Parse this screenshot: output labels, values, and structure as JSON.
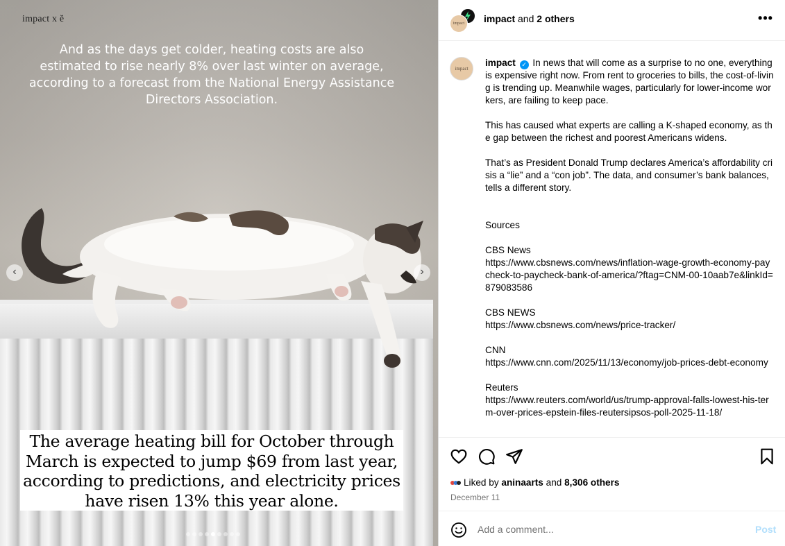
{
  "media": {
    "brand": "impact x ĕ",
    "top_caption": "And as the days get colder, heating costs are also estimated to rise nearly 8% over last winter on average, according to a forecast from the National Energy Assistance Directors Association.",
    "bottom_caption": "The average heating bill for October through March is expected to jump $69 from last year, according to predictions, and electricity prices have risen 13% this year alone.",
    "prev_icon": "chevron-left-icon",
    "next_icon": "chevron-right-icon",
    "slide_count": 9,
    "active_slide": 5
  },
  "header": {
    "username": "impact",
    "and_text": "and",
    "others": "2 others",
    "avatar_text": "impact",
    "more_icon": "more-horizontal-icon"
  },
  "caption": {
    "username": "impact",
    "avatar_text": "impact",
    "verified_icon": "verified-badge-icon",
    "first_paragraph": "In news that will come as a surprise to no one, everything is expensive right now. From rent to groceries to bills, the cost-of-living is trending up. Meanwhile wages, particularly for lower-income workers, are failing to keep pace.",
    "paragraphs": [
      "This has caused what experts are calling a K-shaped economy, as the gap between the richest and poorest Americans widens.",
      "That’s as President Donald Trump declares America’s affordability crisis a “lie” and a “con job”. The data, and consumer’s bank balances, tells a different story."
    ],
    "sources_heading": "Sources",
    "sources": [
      {
        "name": "CBS News",
        "url": "https://www.cbsnews.com/news/inflation-wage-growth-economy-paycheck-to-paycheck-bank-of-america/?ftag=CNM-00-10aab7e&linkId=879083586"
      },
      {
        "name": "CBS NEWS",
        "url": "https://www.cbsnews.com/news/price-tracker/"
      },
      {
        "name": "CNN",
        "url": "https://www.cnn.com/2025/11/13/economy/job-prices-debt-economy"
      },
      {
        "name": "Reuters",
        "url": "https://www.reuters.com/world/us/trump-approval-falls-lowest-his-term-over-prices-epstein-files-reutersipsos-poll-2025-11-18/"
      }
    ]
  },
  "actions": {
    "like_icon": "heart-icon",
    "comment_icon": "comment-icon",
    "share_icon": "send-icon",
    "save_icon": "bookmark-icon",
    "liked_by_prefix": "Liked by",
    "liked_by_user": "aninaarts",
    "liked_by_and": "and",
    "liked_by_others": "8,306 others",
    "date": "December 11"
  },
  "comment": {
    "emoji_icon": "emoji-icon",
    "placeholder": "Add a comment...",
    "post_label": "Post"
  },
  "colors": {
    "accent": "#0095f6",
    "post_disabled": "#b2dffc",
    "muted": "#737373"
  }
}
